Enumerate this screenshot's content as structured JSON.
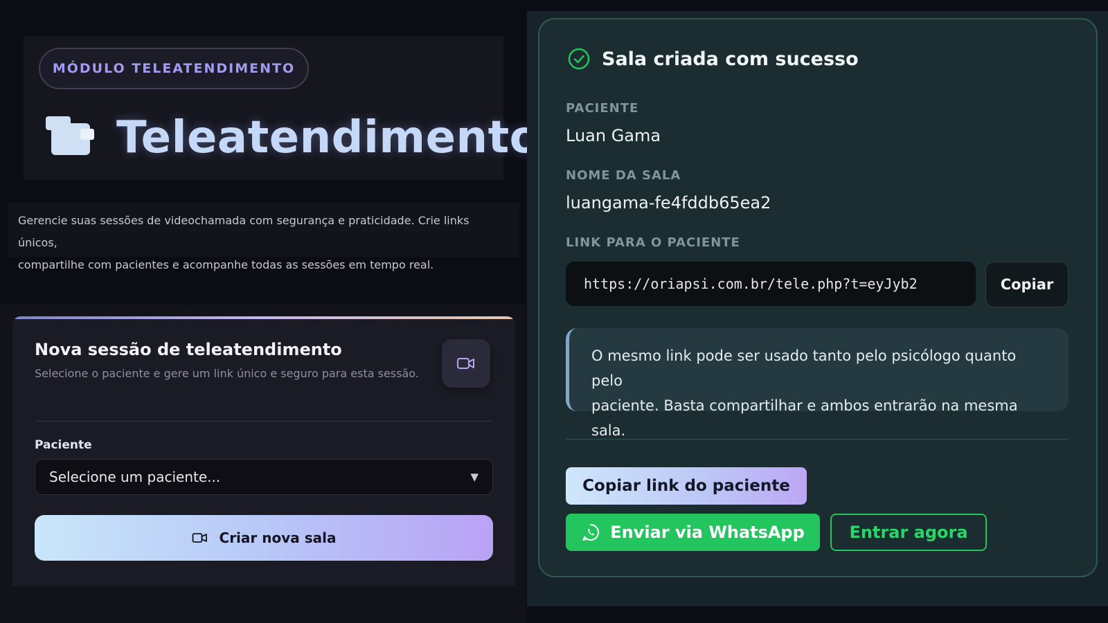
{
  "hero": {
    "badge": "MÓDULO TELEATENDIMENTO",
    "title": "Teleatendimento",
    "description_line1": "Gerencie suas sessões de videochamada com segurança e praticidade. Crie links únicos,",
    "description_line2": "compartilhe com pacientes e acompanhe todas as sessões em tempo real."
  },
  "new_session": {
    "title": "Nova sessão de teleatendimento",
    "subtitle": "Selecione o paciente e gere um link único e seguro para esta sessão.",
    "patient_label": "Paciente",
    "patient_select_value": "Selecione um paciente...",
    "create_button": "Criar nova sala",
    "icon": "video-camera-icon"
  },
  "room": {
    "status": "Sala criada com sucesso",
    "patient_label": "PACIENTE",
    "patient_name": "Luan Gama",
    "room_name_label": "NOME DA SALA",
    "room_name": "luangama-fe4fddb65ea2",
    "link_label": "LINK PARA O PACIENTE",
    "link_value": "https://oriapsi.com.br/tele.php?t=eyJyb2",
    "copy_button": "Copiar",
    "info_line1": "O mesmo link pode ser usado tanto pelo psicólogo quanto pelo",
    "info_line2": "paciente. Basta compartilhar e ambos entrarão na mesma sala.",
    "copy_link_button": "Copiar link do paciente",
    "whatsapp_button": "Enviar via WhatsApp",
    "enter_button": "Entrar agora"
  },
  "colors": {
    "accent_purple": "#a29bf0",
    "success_green": "#22c55e",
    "panel_teal": "#1b2d31"
  }
}
